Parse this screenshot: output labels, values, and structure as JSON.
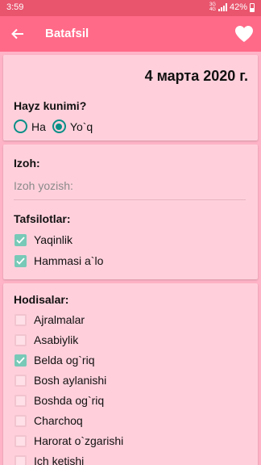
{
  "status": {
    "time": "3:59",
    "network": "3G",
    "network_sub": "4G",
    "battery": "42%"
  },
  "appbar": {
    "title": "Batafsil",
    "back_icon": "arrow-left-icon",
    "action_icon": "heart-icon"
  },
  "date": "4 марта 2020 г.",
  "period": {
    "label": "Hayz kunimi?",
    "options": [
      {
        "label": "Ha",
        "selected": false
      },
      {
        "label": "Yo`q",
        "selected": true
      }
    ]
  },
  "note": {
    "label": "Izoh:",
    "placeholder": "Izoh yozish:",
    "value": ""
  },
  "details": {
    "label": "Tafsilotlar:",
    "items": [
      {
        "label": "Yaqinlik",
        "checked": true
      },
      {
        "label": "Hammasi a`lo",
        "checked": true
      }
    ]
  },
  "events": {
    "label": "Hodisalar:",
    "items": [
      {
        "label": "Ajralmalar",
        "checked": false
      },
      {
        "label": "Asabiylik",
        "checked": false
      },
      {
        "label": "Belda og`riq",
        "checked": true
      },
      {
        "label": "Bosh aylanishi",
        "checked": false
      },
      {
        "label": "Boshda og`riq",
        "checked": false
      },
      {
        "label": "Charchoq",
        "checked": false
      },
      {
        "label": "Harorat o`zgarishi",
        "checked": false
      },
      {
        "label": "Ich ketishi",
        "checked": false
      }
    ]
  },
  "colors": {
    "statusbar": "#e8556d",
    "appbar": "#ff6a88",
    "background": "#ffb3c6",
    "card": "#ffd0dc",
    "accent": "#0a8f87",
    "checkbox_on": "#78c9b7"
  }
}
